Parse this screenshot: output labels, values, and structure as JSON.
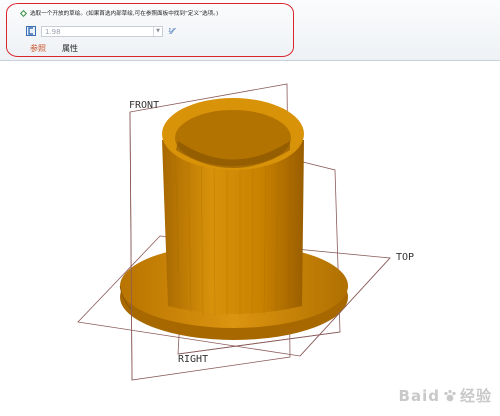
{
  "dashboard": {
    "prompt": "选取一个开放的草绘。(如果首选内部草绘,可在参照面板中找到“定义”选项。)",
    "value": "1.98",
    "tabs": [
      {
        "label": "参照",
        "active": true
      },
      {
        "label": "属性",
        "active": false
      }
    ]
  },
  "viewport": {
    "planes": [
      "FRONT",
      "TOP",
      "RIGHT"
    ],
    "model_color": "#d08a00"
  },
  "watermark": {
    "text": "Baid",
    "cn": "经验"
  },
  "colors": {
    "highlight": "#d9262e",
    "active_tab": "#c8532a",
    "model": "#d08a00"
  }
}
